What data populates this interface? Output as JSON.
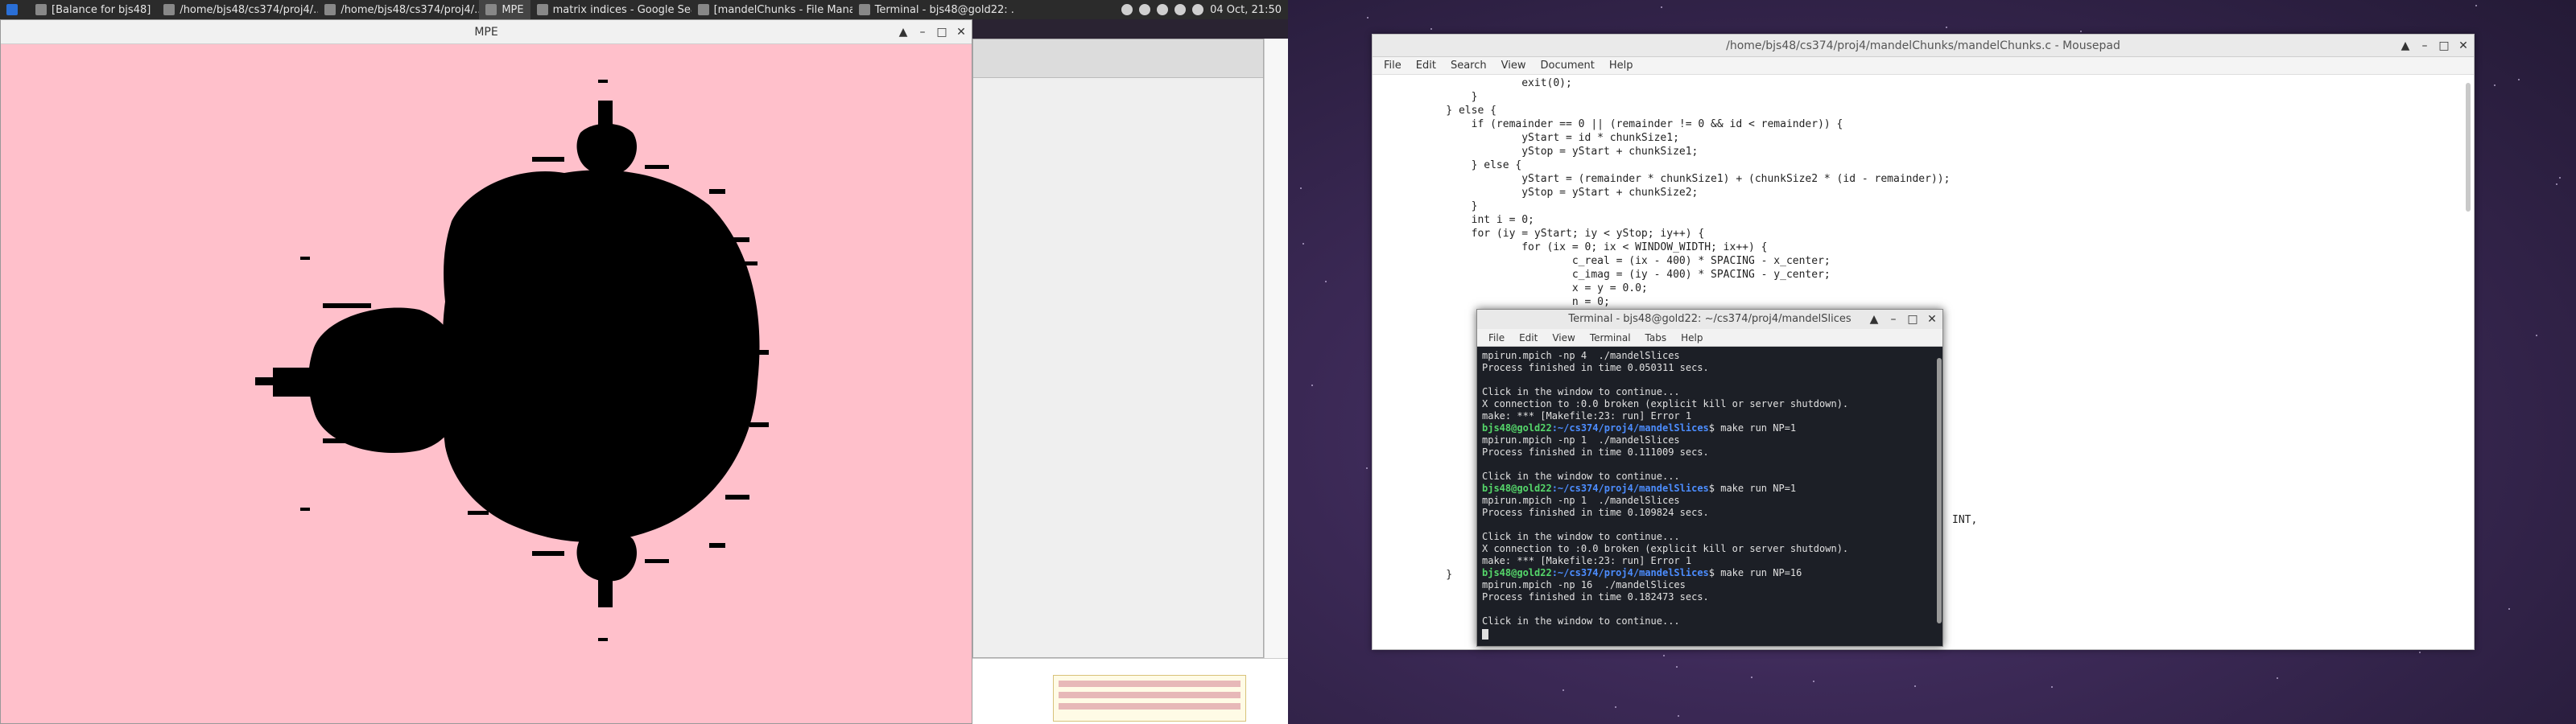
{
  "taskbar": {
    "items": [
      {
        "label": "[Balance for bjs48]",
        "active": false
      },
      {
        "label": "/home/bjs48/cs374/proj4/...",
        "active": false
      },
      {
        "label": "/home/bjs48/cs374/proj4/...",
        "active": false
      },
      {
        "label": "MPE",
        "active": true
      },
      {
        "label": "matrix indices - Google Sea...",
        "active": false
      },
      {
        "label": "[mandelChunks - File Mana...",
        "active": false
      },
      {
        "label": "Terminal - bjs48@gold22: ...",
        "active": false
      }
    ],
    "clock": "04 Oct, 21:50"
  },
  "mpe": {
    "title": "MPE",
    "bg_color": "#ffc0cb"
  },
  "mousepad": {
    "title": "/home/bjs48/cs374/proj4/mandelChunks/mandelChunks.c - Mousepad",
    "menu": [
      "File",
      "Edit",
      "Search",
      "View",
      "Document",
      "Help"
    ],
    "code_lines": [
      "                exit(0);",
      "        }",
      "    } else {",
      "        if (remainder == 0 || (remainder != 0 && id < remainder)) {",
      "                yStart = id * chunkSize1;",
      "                yStop = yStart + chunkSize1;",
      "        } else {",
      "                yStart = (remainder * chunkSize1) + (chunkSize2 * (id - remainder));",
      "                yStop = yStart + chunkSize2;",
      "        }",
      "        int i = 0;",
      "        for (iy = yStart; iy < yStop; iy++) {",
      "                for (ix = 0; ix < WINDOW_WIDTH; ix++) {",
      "                        c_real = (ix - 400) * SPACING - x_center;",
      "                        c_imag = (iy - 400) * SPACING - y_center;",
      "                        x = y = 0.0;",
      "                        n = 0;"
    ],
    "partial_tail": "INT,",
    "closing_brace": "    }"
  },
  "terminal": {
    "title": "Terminal - bjs48@gold22: ~/cs374/proj4/mandelSlices",
    "menu": [
      "File",
      "Edit",
      "View",
      "Terminal",
      "Tabs",
      "Help"
    ],
    "prompt_user": "bjs48@gold22",
    "prompt_path": ":~/cs374/proj4/mandelSlices",
    "lines": [
      {
        "t": "out",
        "text": "mpirun.mpich -np 4  ./mandelSlices"
      },
      {
        "t": "out",
        "text": "Process finished in time 0.050311 secs."
      },
      {
        "t": "out",
        "text": ""
      },
      {
        "t": "out",
        "text": "Click in the window to continue..."
      },
      {
        "t": "out",
        "text": "X connection to :0.0 broken (explicit kill or server shutdown)."
      },
      {
        "t": "out",
        "text": "make: *** [Makefile:23: run] Error 1"
      },
      {
        "t": "cmd",
        "text": "$ make run NP=1"
      },
      {
        "t": "out",
        "text": "mpirun.mpich -np 1  ./mandelSlices"
      },
      {
        "t": "out",
        "text": "Process finished in time 0.111009 secs."
      },
      {
        "t": "out",
        "text": ""
      },
      {
        "t": "out",
        "text": "Click in the window to continue..."
      },
      {
        "t": "cmd",
        "text": "$ make run NP=1"
      },
      {
        "t": "out",
        "text": "mpirun.mpich -np 1  ./mandelSlices"
      },
      {
        "t": "out",
        "text": "Process finished in time 0.109824 secs."
      },
      {
        "t": "out",
        "text": ""
      },
      {
        "t": "out",
        "text": "Click in the window to continue..."
      },
      {
        "t": "out",
        "text": "X connection to :0.0 broken (explicit kill or server shutdown)."
      },
      {
        "t": "out",
        "text": "make: *** [Makefile:23: run] Error 1"
      },
      {
        "t": "cmd",
        "text": "$ make run NP=16"
      },
      {
        "t": "out",
        "text": "mpirun.mpich -np 16  ./mandelSlices"
      },
      {
        "t": "out",
        "text": "Process finished in time 0.182473 secs."
      },
      {
        "t": "out",
        "text": ""
      },
      {
        "t": "out",
        "text": "Click in the window to continue..."
      }
    ]
  },
  "colors": {
    "accent_green": "#55d66a",
    "accent_blue": "#4c8dff"
  }
}
